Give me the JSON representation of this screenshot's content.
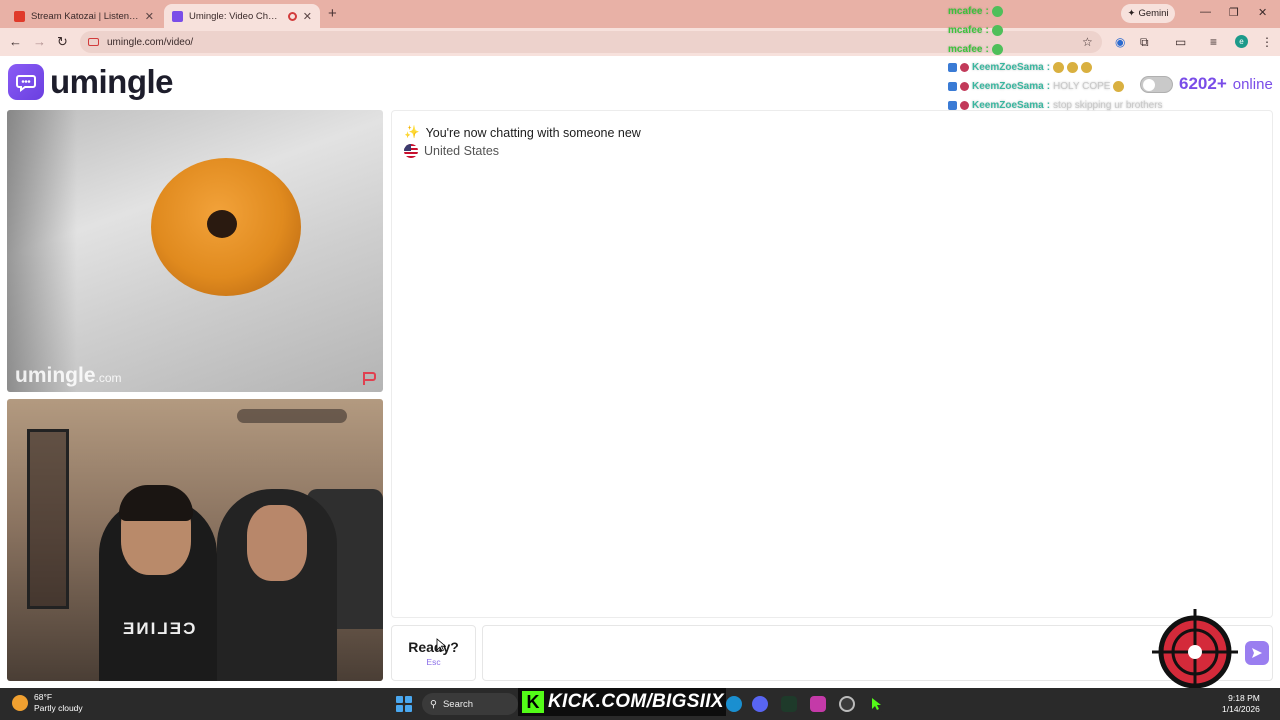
{
  "browser": {
    "tabs": [
      {
        "title": "Stream Katozai | Listen to top h",
        "active": false
      },
      {
        "title": "Umingle: Video Chat with S",
        "active": true
      }
    ],
    "new_tab": "+",
    "gemini_label": "Gemini",
    "url": "umingle.com/video/",
    "profile_initial": "e"
  },
  "site": {
    "logo_text": "umingle",
    "online_count": "6202+",
    "online_label": "online"
  },
  "videos": {
    "stranger_watermark": "umingle",
    "stranger_watermark_suffix": ".com",
    "self_shirt_text": "CELINE"
  },
  "chat": {
    "status_message": "You're now chatting with someone new",
    "country": "United States",
    "ready_label": "Ready?",
    "ready_key": "Esc",
    "input_value": ""
  },
  "overlay_chat": [
    {
      "name": "mcafee",
      "text": "",
      "style": "green"
    },
    {
      "name": "mcafee",
      "text": "",
      "style": "green"
    },
    {
      "name": "mcafee",
      "text": "",
      "style": "green"
    },
    {
      "name": "KeemZoeSama",
      "text": "",
      "style": "teal"
    },
    {
      "name": "KeemZoeSama",
      "text": "HOLY COPE",
      "style": "teal"
    },
    {
      "name": "KeemZoeSama",
      "text": "stop skipping ur brothers",
      "style": "teal"
    }
  ],
  "stream_banner": "KICK.COM/BIGSIIX",
  "taskbar": {
    "temperature": "68°F",
    "weather": "Partly cloudy",
    "search": "Search",
    "time": "9:18 PM",
    "date": "1/14/2026"
  },
  "colors": {
    "accent": "#7a4de8",
    "chrome_tab_bar": "#e8b1a6",
    "chrome_toolbar": "#f7e1dc",
    "kick_green": "#53fc18"
  }
}
